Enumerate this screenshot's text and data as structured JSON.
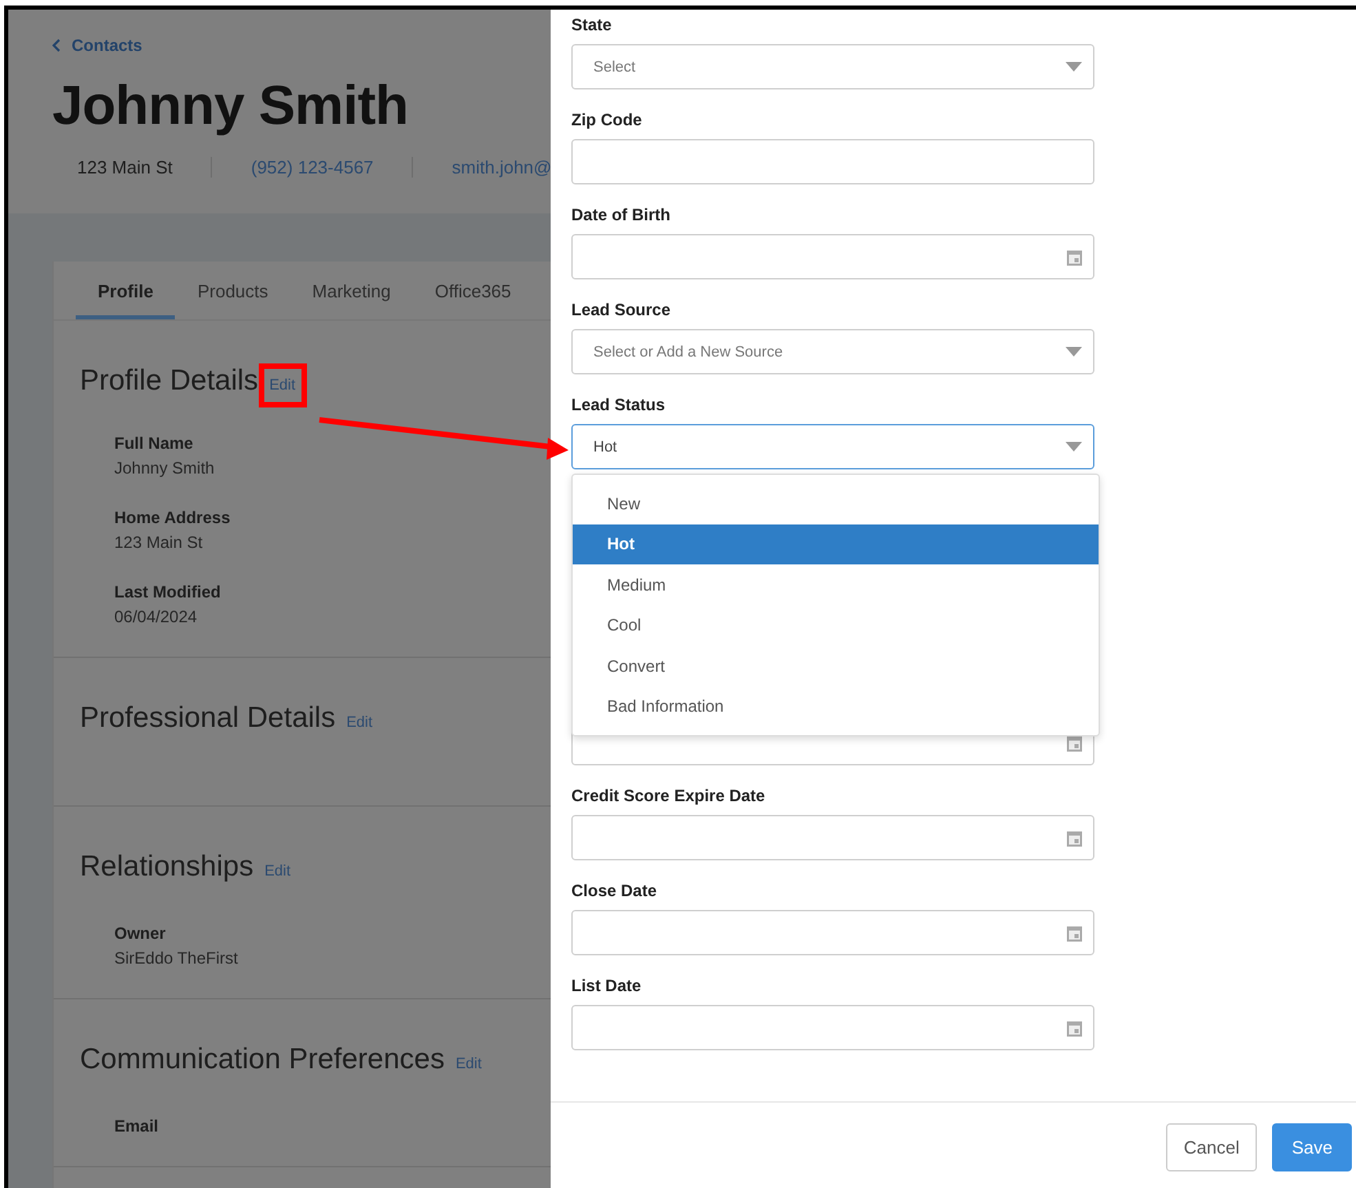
{
  "back_link": {
    "label": "Contacts"
  },
  "contact": {
    "name": "Johnny Smith",
    "details": [
      "123 Main St",
      "(952) 123-4567",
      "smith.john@"
    ]
  },
  "tabs": [
    {
      "label": "Profile",
      "selected": true
    },
    {
      "label": "Products",
      "selected": false
    },
    {
      "label": "Marketing",
      "selected": false
    },
    {
      "label": "Office365",
      "selected": false
    }
  ],
  "sections": [
    {
      "title": "Profile Details",
      "edit": "Edit",
      "annotated": true,
      "fields": [
        {
          "label": "Full Name",
          "value": "Johnny Smith"
        },
        {
          "label": "Home Address",
          "value": "123 Main St"
        },
        {
          "label": "Last Modified",
          "value": "06/04/2024"
        }
      ]
    },
    {
      "title": "Professional Details",
      "edit": "Edit",
      "annotated": false
    },
    {
      "title": "Relationships",
      "edit": "Edit",
      "annotated": false,
      "fields": [
        {
          "label": "Owner",
          "value": "SirEddo TheFirst"
        }
      ]
    },
    {
      "title": "Communication Preferences",
      "edit": "Edit",
      "annotated": false,
      "fields": [
        {
          "label": "Email"
        }
      ]
    }
  ],
  "form": {
    "fields": [
      {
        "kind": "select",
        "label": "State",
        "placeholder": "Select"
      },
      {
        "kind": "text",
        "label": "Zip Code"
      },
      {
        "kind": "date",
        "label": "Date of Birth"
      },
      {
        "kind": "select",
        "label": "Lead Source",
        "placeholder": "Select or Add a New Source"
      },
      {
        "kind": "select",
        "label": "Lead Status",
        "value": "Hot",
        "expanded": true,
        "options": [
          {
            "label": "New",
            "selected": false
          },
          {
            "label": "Hot",
            "selected": true
          },
          {
            "label": "Medium",
            "selected": false
          },
          {
            "label": "Cool",
            "selected": false
          },
          {
            "label": "Convert",
            "selected": false
          },
          {
            "label": "Bad Information",
            "selected": false
          }
        ]
      },
      {
        "kind": "date"
      },
      {
        "kind": "date",
        "label": "Credit Score Expire Date"
      },
      {
        "kind": "date",
        "label": "Close Date"
      },
      {
        "kind": "date",
        "label": "List Date"
      }
    ]
  },
  "footer": {
    "buttons": [
      {
        "label": "Cancel",
        "kind": "secondary"
      },
      {
        "label": "Save",
        "kind": "primary"
      }
    ]
  }
}
